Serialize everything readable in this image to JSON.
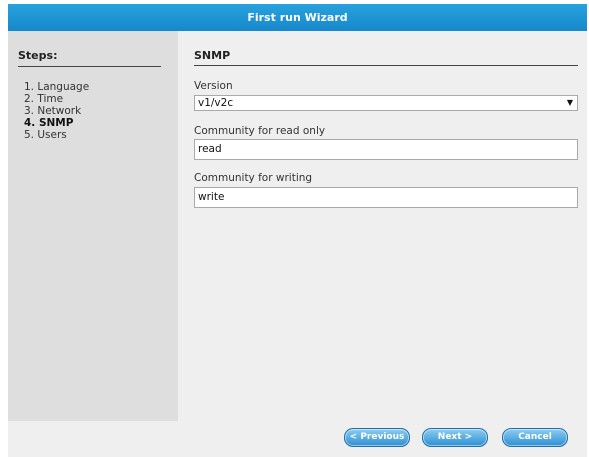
{
  "window": {
    "title": "First run Wizard"
  },
  "sidebar": {
    "title": "Steps:",
    "steps": [
      {
        "label": "1. Language"
      },
      {
        "label": "2. Time"
      },
      {
        "label": "3. Network"
      },
      {
        "label": "4. SNMP",
        "active": true
      },
      {
        "label": "5. Users"
      }
    ]
  },
  "section": {
    "title": "SNMP"
  },
  "fields": {
    "version": {
      "label": "Version",
      "value": "v1/v2c"
    },
    "read_community": {
      "label": "Community for read only",
      "value": "read"
    },
    "write_community": {
      "label": "Community for writing",
      "value": "write"
    }
  },
  "buttons": {
    "previous": "< Previous",
    "next": "Next >",
    "cancel": "Cancel"
  },
  "colors": {
    "titlebar": "#1f95d6",
    "sidebar": "#dedede",
    "content": "#efefef",
    "button": "#2b8fd4"
  }
}
